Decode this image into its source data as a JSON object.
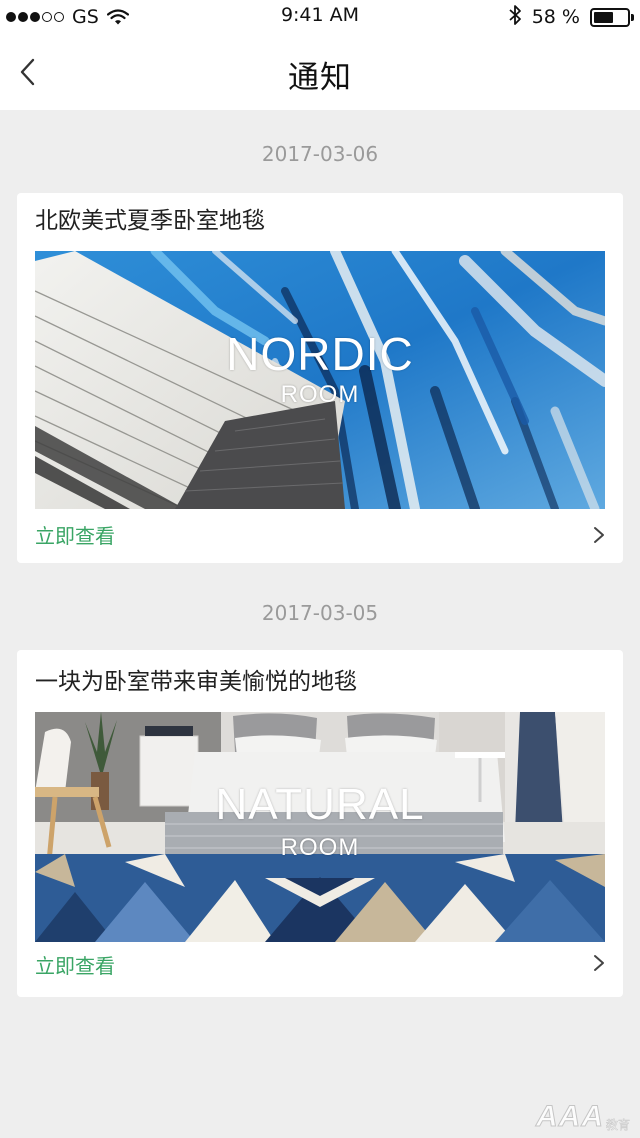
{
  "status_bar": {
    "carrier": "GS",
    "signal_bars_filled": 3,
    "signal_bars_total": 5,
    "time": "9:41 AM",
    "battery_percent": "58 %",
    "battery_level": 0.58,
    "icons": [
      "signal-dots-icon",
      "wifi-icon",
      "bluetooth-icon",
      "battery-icon"
    ]
  },
  "nav": {
    "back_icon": "chevron-left-icon",
    "title": "通知"
  },
  "notifications": [
    {
      "date": "2017-03-06",
      "title": "北欧美式夏季卧室地毯",
      "banner_title": "NORDIC",
      "banner_subtitle": "ROOM",
      "action_label": "立即查看",
      "action_icon": "chevron-right-icon"
    },
    {
      "date": "2017-03-05",
      "title": "一块为卧室带来审美愉悦的地毯",
      "banner_title": "NATURAL",
      "banner_subtitle": "ROOM",
      "action_label": "立即查看",
      "action_icon": "chevron-right-icon"
    }
  ],
  "watermark": {
    "main": "AAA",
    "sub": "教育"
  },
  "colors": {
    "background": "#eeeeee",
    "card": "#ffffff",
    "accent_green": "#3aa565",
    "date_gray": "#9a9a9a"
  }
}
